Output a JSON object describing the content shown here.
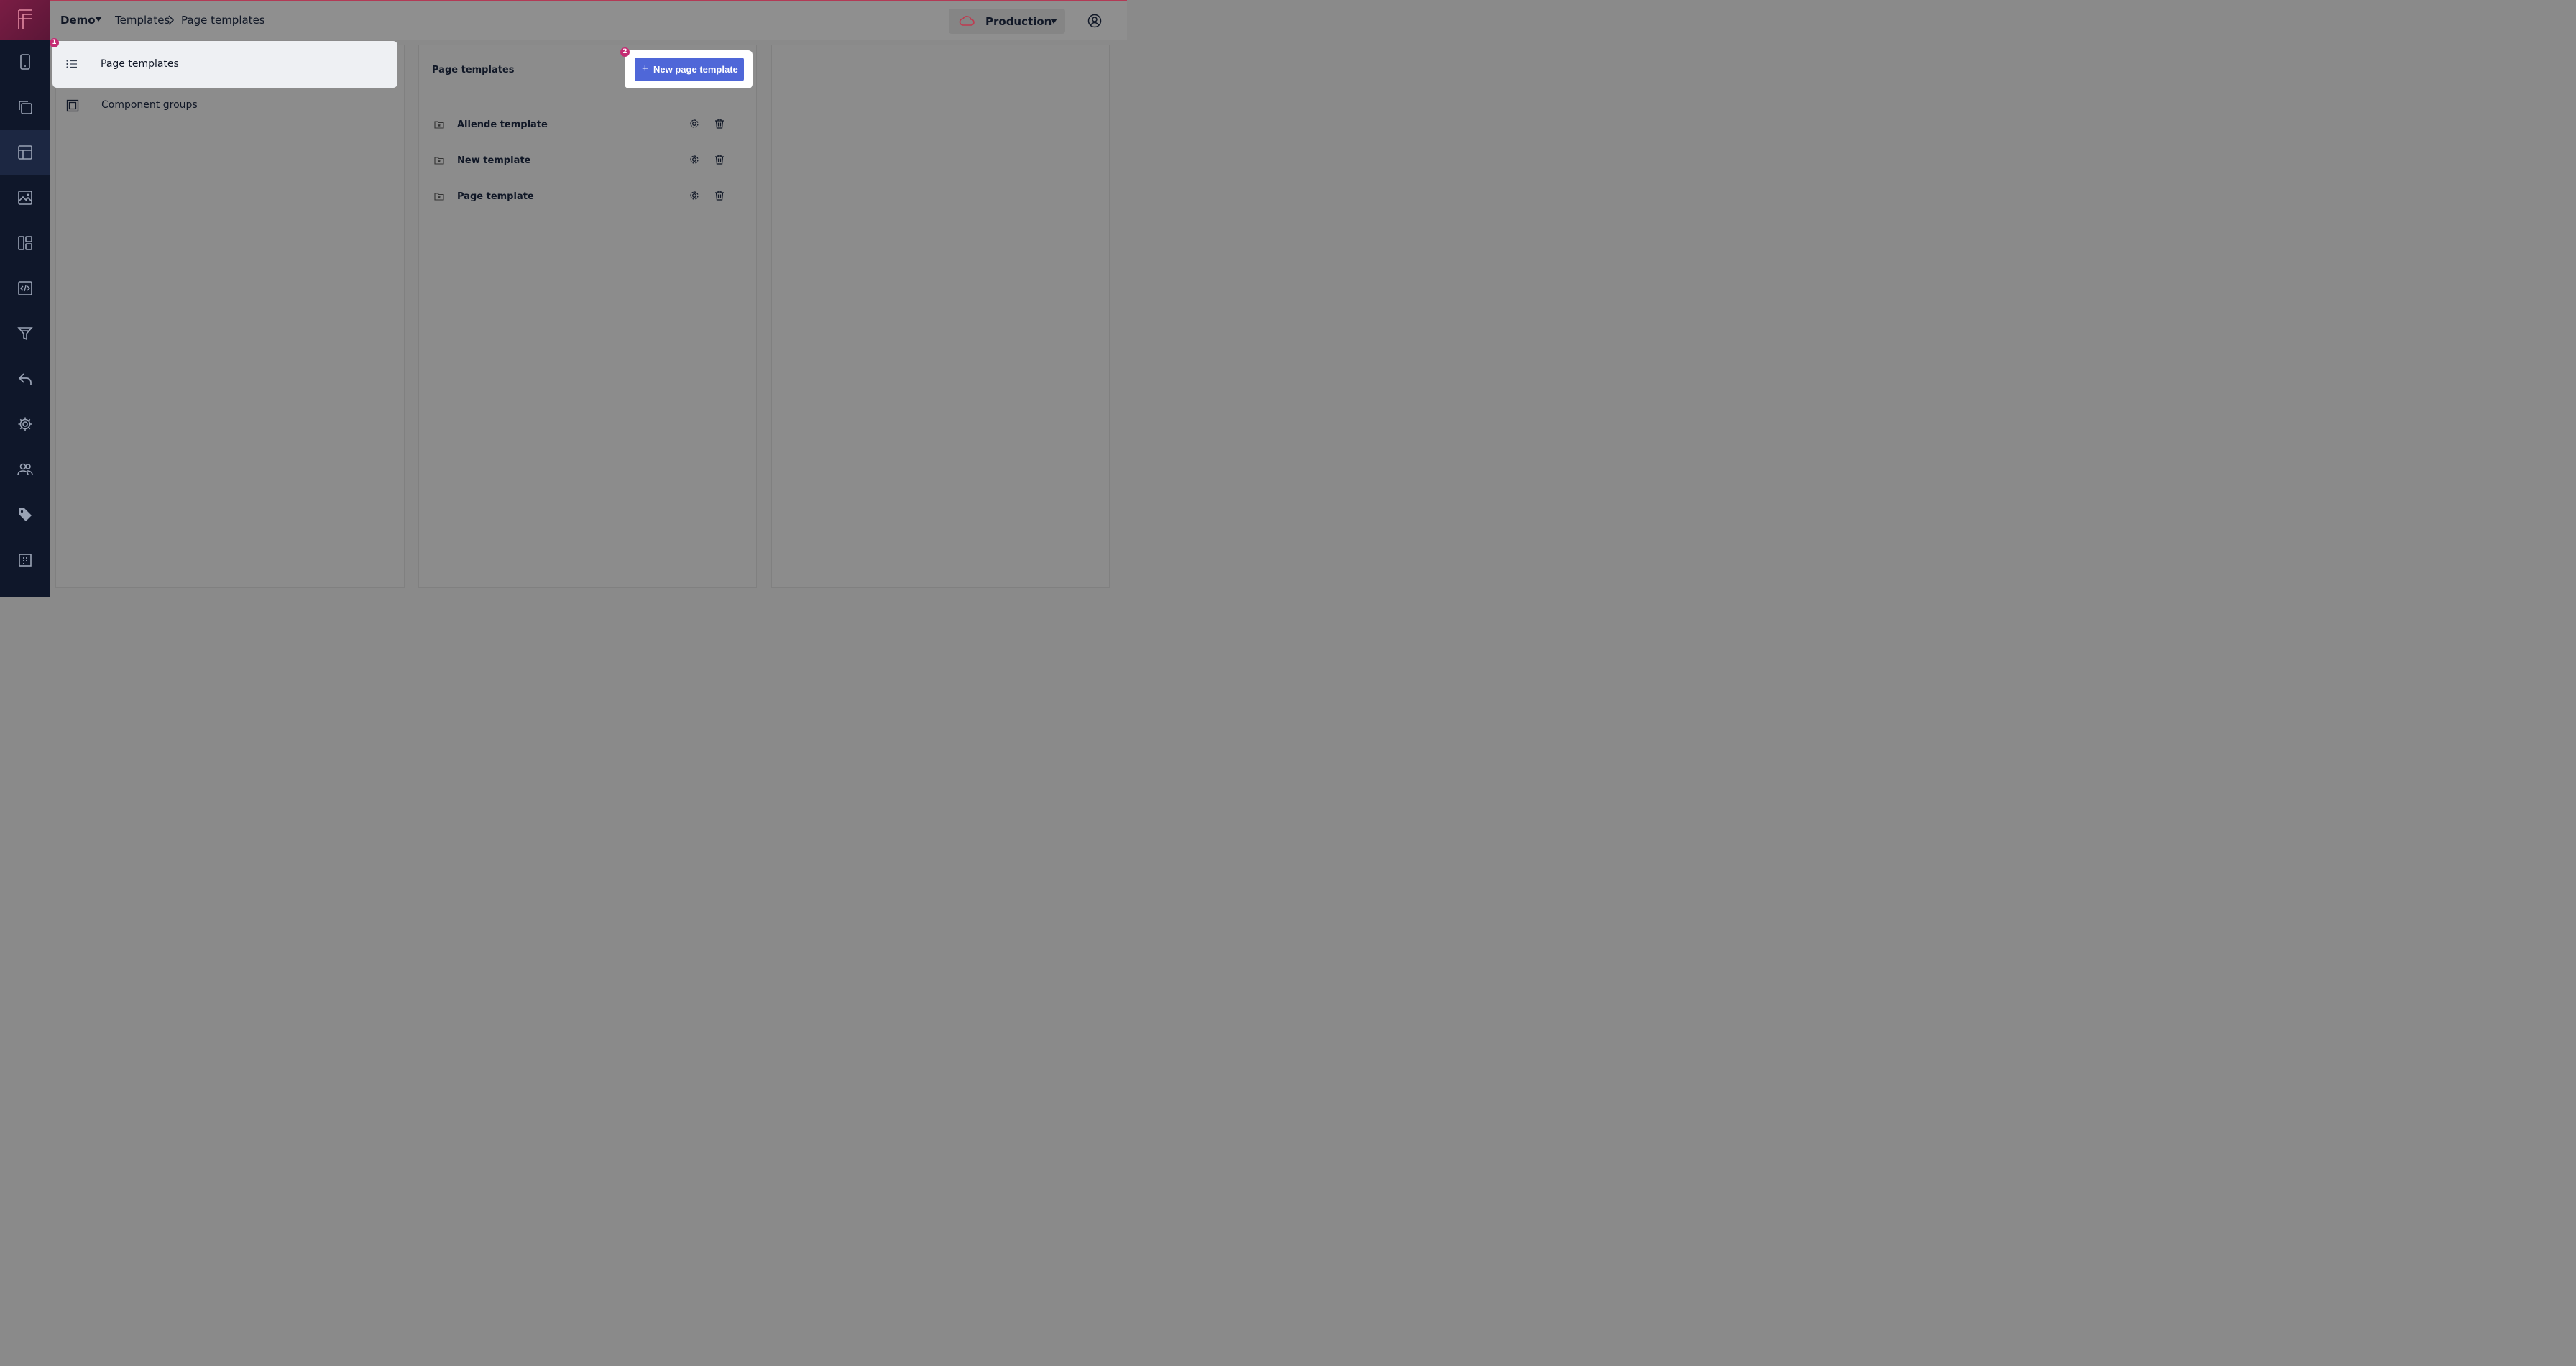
{
  "topbar": {
    "workspace": "Demo",
    "breadcrumb": [
      "Templates",
      "Page templates"
    ],
    "environment": "Production",
    "env_icon": "cloud-icon",
    "user_icon": "user-circle-icon"
  },
  "rail": {
    "logo": "F",
    "items": [
      {
        "icon": "device-icon"
      },
      {
        "icon": "pages-icon"
      },
      {
        "icon": "templates-icon",
        "active": true
      },
      {
        "icon": "image-icon"
      },
      {
        "icon": "layout-icon"
      },
      {
        "icon": "code-icon"
      },
      {
        "icon": "filter-icon"
      },
      {
        "icon": "reply-icon"
      },
      {
        "icon": "settings-icon"
      },
      {
        "icon": "users-icon"
      },
      {
        "icon": "tag-icon"
      },
      {
        "icon": "grid-icon"
      }
    ]
  },
  "left_panel": {
    "items": [
      {
        "label": "Page templates",
        "icon": "list-icon",
        "badge": "1"
      },
      {
        "label": "Component groups",
        "icon": "box-icon"
      }
    ]
  },
  "middle_panel": {
    "title": "Page templates",
    "new_button": "New page template",
    "badge": "2",
    "templates": [
      {
        "name": "Allende template"
      },
      {
        "name": "New template"
      },
      {
        "name": "Page template"
      }
    ]
  },
  "colors": {
    "rail": "#0f172a",
    "accent": "#4f67d8",
    "badge": "#c42c73",
    "overlay": "#8c8c8c"
  }
}
